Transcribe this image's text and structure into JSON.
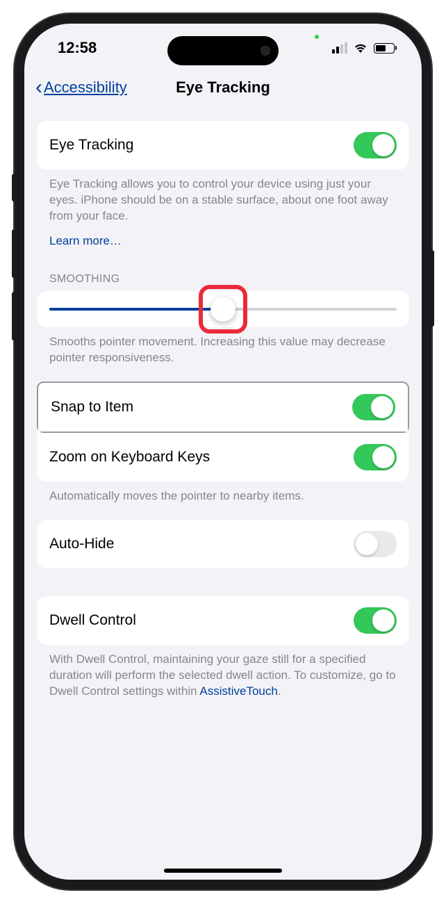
{
  "status": {
    "time": "12:58"
  },
  "nav": {
    "back_label": "Accessibility",
    "title": "Eye Tracking"
  },
  "rows": {
    "eye_tracking": {
      "label": "Eye Tracking",
      "on": true
    },
    "snap_to_item": {
      "label": "Snap to Item",
      "on": true
    },
    "zoom_keys": {
      "label": "Zoom on Keyboard Keys",
      "on": true
    },
    "auto_hide": {
      "label": "Auto-Hide",
      "on": false
    },
    "dwell": {
      "label": "Dwell Control",
      "on": true
    }
  },
  "footers": {
    "eye_tracking": "Eye Tracking allows you to control your device using just your eyes. iPhone should be on a stable surface, about one foot away from your face.",
    "learn_more": "Learn more…",
    "smoothing_header": "SMOOTHING",
    "smoothing_desc": "Smooths pointer movement. Increasing this value may decrease pointer responsiveness.",
    "snap_desc": "Automatically moves the pointer to nearby items.",
    "dwell_pre": "With Dwell Control, maintaining your gaze still for a specified duration will perform the selected dwell action. To customize, go to Dwell Control settings within ",
    "dwell_link": "AssistiveTouch",
    "dwell_post": "."
  },
  "slider": {
    "value_percent": 50
  }
}
